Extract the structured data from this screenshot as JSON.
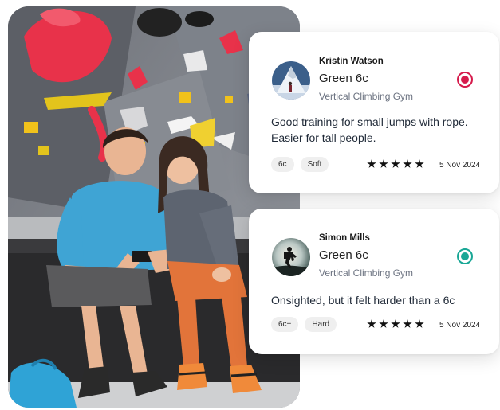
{
  "reviews": [
    {
      "author": "Kristin Watson",
      "route": "Green 6c",
      "gym": "Vertical Climbing Gym",
      "comment": "Good training for small jumps with rope. Easier for tall people.",
      "tags": [
        "6c",
        "Soft"
      ],
      "rating": 5,
      "date": "5 Nov 2024",
      "status_color": "#d61b4c",
      "avatar_icon": "mountain-peak-climber"
    },
    {
      "author": "Simon Mills",
      "route": "Green 6c",
      "gym": "Vertical Climbing Gym",
      "comment": "Onsighted, but it felt harder than a 6c",
      "tags": [
        "6c+",
        "Hard"
      ],
      "rating": 5,
      "date": "5 Nov 2024",
      "status_color": "#19a796",
      "avatar_icon": "hiker-silhouette"
    }
  ],
  "photo": {
    "subject": "climbers-looking-at-phone"
  }
}
